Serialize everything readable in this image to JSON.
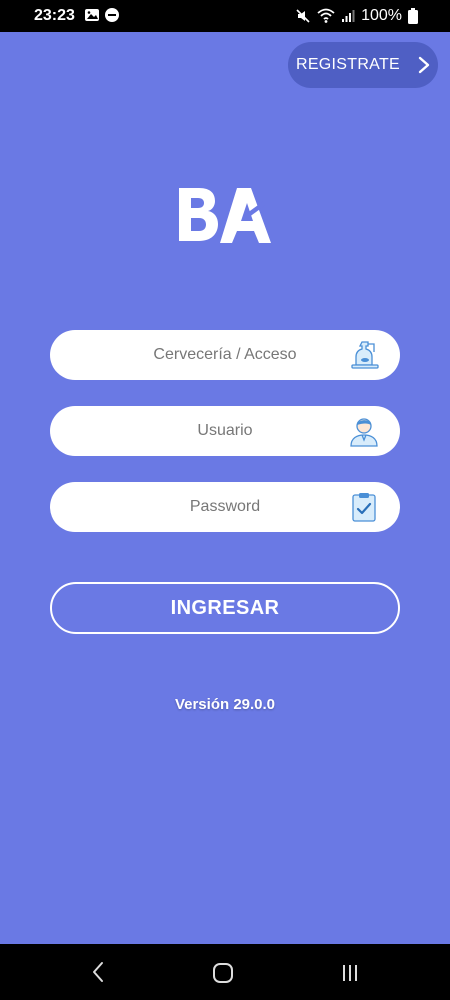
{
  "status_bar": {
    "time": "23:23",
    "battery": "100%"
  },
  "header": {
    "register_label": "REGISTRATE"
  },
  "logo_text": "BA",
  "form": {
    "brewery_placeholder": "Cervecería / Acceso",
    "user_placeholder": "Usuario",
    "password_placeholder": "Password",
    "login_label": "INGRESAR"
  },
  "version": "Versión 29.0.0",
  "colors": {
    "background": "#6a79e4",
    "register_bg": "#4f5fc4",
    "icon_blue": "#6aa9e8"
  }
}
